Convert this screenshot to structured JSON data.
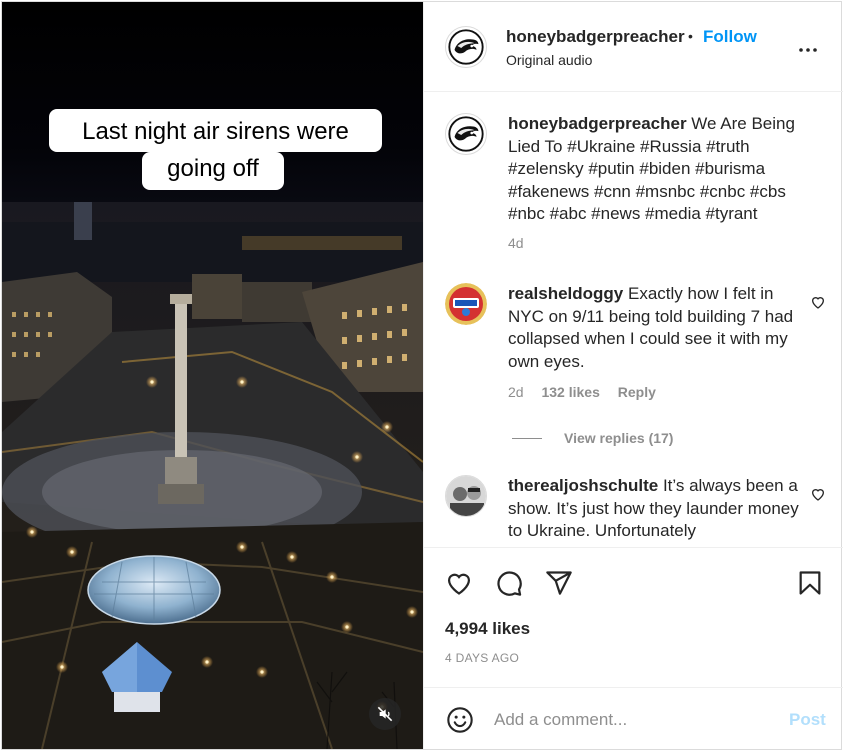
{
  "header": {
    "username": "honeybadgerpreacher",
    "separator": "•",
    "follow_label": "Follow",
    "audio_label": "Original audio"
  },
  "video": {
    "caption_line1": "Last night air sirens were",
    "caption_line2": "going off",
    "mute_icon": "speaker-muted-icon"
  },
  "post_caption": {
    "username": "honeybadgerpreacher",
    "text": "We Are Being Lied To #Ukraine #Russia #truth #zelensky #putin #biden #burisma #fakenews #cnn #msnbc #cnbc #cbs #nbc #abc #news #media #tyrant",
    "age": "4d"
  },
  "comments": [
    {
      "username": "realsheldoggy",
      "text": "Exactly how I felt in NYC on 9/11 being told building 7 had collapsed when I could see it with my own eyes.",
      "age": "2d",
      "likes": "132 likes",
      "reply_label": "Reply",
      "view_replies": "View replies (17)"
    },
    {
      "username": "therealjoshschulte",
      "text": "It’s always been a show. It’s just how they launder money to Ukraine. Unfortunately"
    }
  ],
  "actions": {
    "likes": "4,994 likes",
    "date": "4 DAYS AGO"
  },
  "add_comment": {
    "placeholder": "Add a comment...",
    "post_label": "Post"
  },
  "colors": {
    "accent": "#0095f6",
    "post_disabled": "#b2dffc",
    "muted_text": "#8e8e8e"
  }
}
